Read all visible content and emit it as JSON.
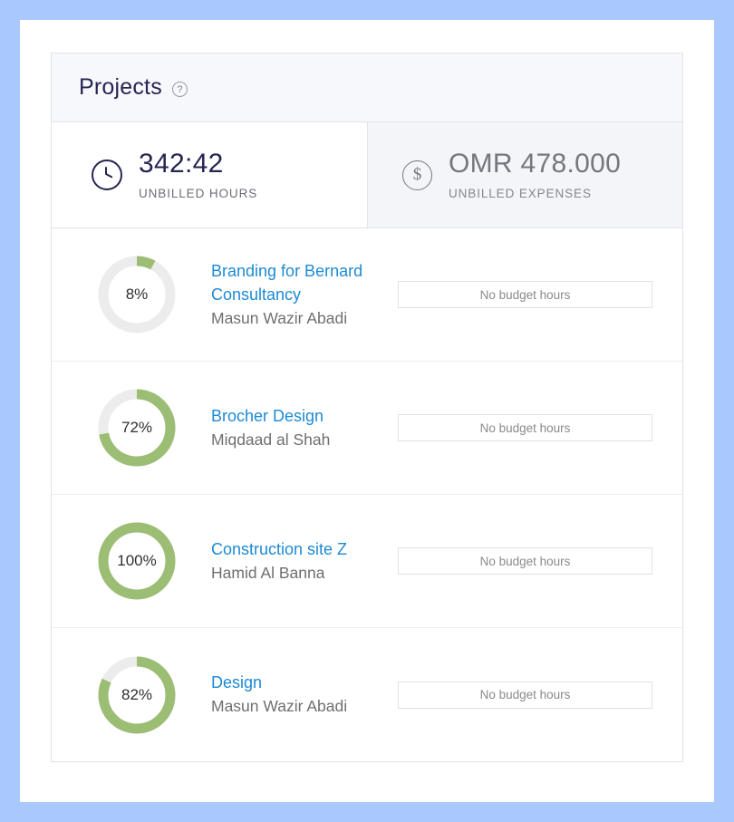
{
  "theme": {
    "frame_color": "#a9c9fc",
    "accent_link": "#1c8ad4",
    "progress_green": "#9cbd74",
    "progress_track": "#ececec",
    "title_navy": "#252551"
  },
  "card": {
    "title": "Projects",
    "help_icon": "help-circle-icon",
    "help_glyph": "?"
  },
  "stats": [
    {
      "icon": "clock-icon",
      "value": "342:42",
      "label": "UNBILLED HOURS",
      "state": "active"
    },
    {
      "icon": "dollar-circle-icon",
      "value": "OMR 478.000",
      "label": "UNBILLED EXPENSES",
      "state": "inactive"
    }
  ],
  "projects": [
    {
      "percent": 8,
      "percent_label": "8%",
      "name": "Branding for Bernard Consultancy",
      "client": "Masun Wazir Abadi",
      "budget": "No budget hours"
    },
    {
      "percent": 72,
      "percent_label": "72%",
      "name": "Brocher Design",
      "client": "Miqdaad al Shah",
      "budget": "No budget hours"
    },
    {
      "percent": 100,
      "percent_label": "100%",
      "name": "Construction site Z",
      "client": "Hamid Al Banna",
      "budget": "No budget hours"
    },
    {
      "percent": 82,
      "percent_label": "82%",
      "name": "Design",
      "client": "Masun Wazir Abadi",
      "budget": "No budget hours"
    }
  ]
}
